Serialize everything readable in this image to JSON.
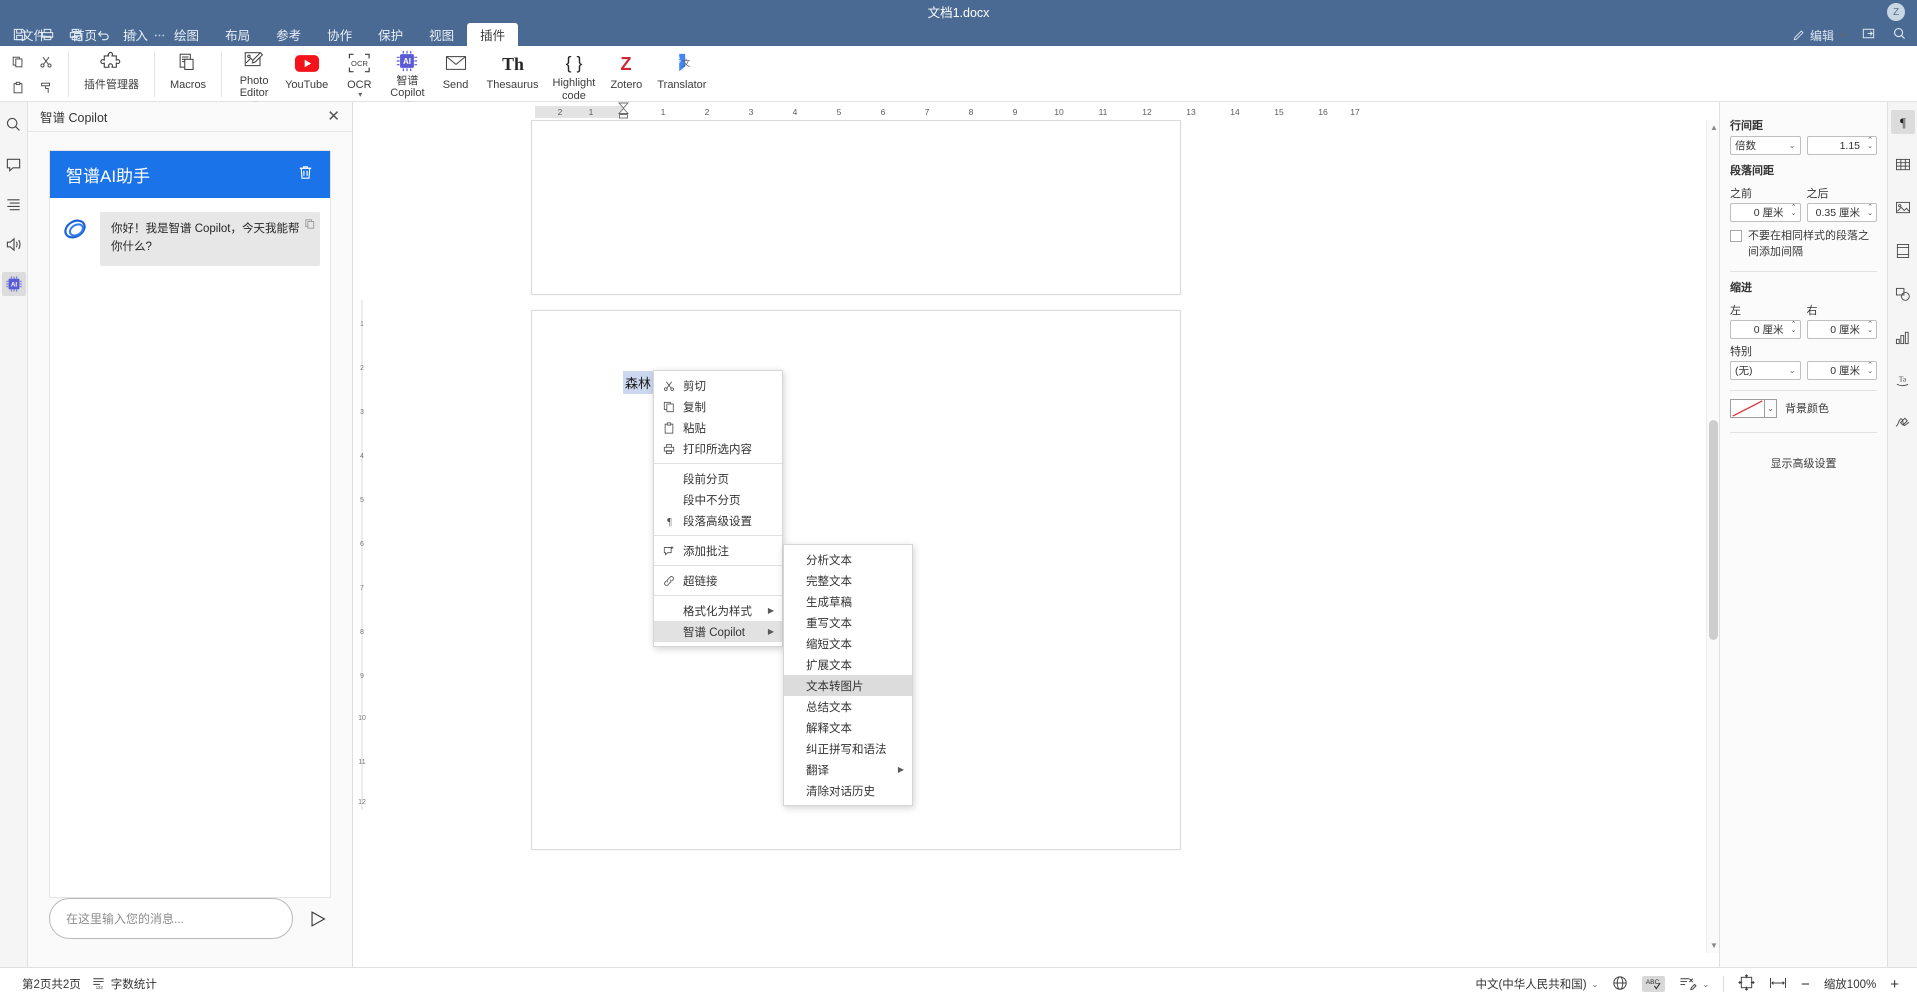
{
  "titlebar": {
    "doc_title": "文档1.docx",
    "avatar_initial": "Z",
    "quick_access": [
      "save-icon",
      "print-icon",
      "print-preview-icon",
      "undo-icon",
      "redo-icon",
      "more-icon"
    ],
    "edit_label": "编辑"
  },
  "tabs": [
    {
      "label": "文件",
      "active": false
    },
    {
      "label": "首页",
      "active": false
    },
    {
      "label": "插入",
      "active": false
    },
    {
      "label": "绘图",
      "active": false
    },
    {
      "label": "布局",
      "active": false
    },
    {
      "label": "参考",
      "active": false
    },
    {
      "label": "协作",
      "active": false
    },
    {
      "label": "保护",
      "active": false
    },
    {
      "label": "视图",
      "active": false
    },
    {
      "label": "插件",
      "active": true
    }
  ],
  "ribbon": {
    "clipboard": [
      "copy-icon",
      "cut-icon",
      "paste-icon",
      "format-painter-icon"
    ],
    "items": [
      {
        "label": "插件管理器",
        "icon": "puzzle-icon",
        "caret": false
      },
      {
        "label": "Macros",
        "icon": "macros-icon",
        "caret": false
      },
      {
        "label": "Photo\nEditor",
        "icon": "photo-editor-icon",
        "caret": true
      },
      {
        "label": "YouTube",
        "icon": "youtube-icon",
        "caret": false
      },
      {
        "label": "OCR",
        "icon": "ocr-icon",
        "caret": true
      },
      {
        "label": "智谱\nCopilot",
        "icon": "ai-chip-icon",
        "caret": true
      },
      {
        "label": "Send",
        "icon": "envelope-icon",
        "caret": false
      },
      {
        "label": "Thesaurus",
        "icon": "th-icon",
        "caret": false
      },
      {
        "label": "Highlight\ncode",
        "icon": "braces-icon",
        "caret": false
      },
      {
        "label": "Zotero",
        "icon": "zotero-z-icon",
        "caret": false
      },
      {
        "label": "Translator",
        "icon": "translator-icon",
        "caret": false
      }
    ]
  },
  "left_rail": [
    {
      "name": "search-icon",
      "active": false
    },
    {
      "name": "comment-icon",
      "active": false
    },
    {
      "name": "headings-icon",
      "active": false
    },
    {
      "name": "text-to-speech-icon",
      "active": false
    },
    {
      "name": "ai-plugin-icon",
      "active": true
    }
  ],
  "copilot": {
    "panel_title": "智谱 Copilot",
    "close_label": "✕",
    "banner_title": "智谱AI助手",
    "messages": [
      {
        "role": "assistant",
        "text": "你好！我是智谱 Copilot，今天我能帮你什么?"
      }
    ],
    "input_placeholder": "在这里输入您的消息...",
    "input_value": "",
    "send_icon": "send-icon",
    "delete_icon": "trash-icon",
    "copy_icon": "copy-icon",
    "banner_color": "#1a73e8"
  },
  "document": {
    "selected_text": "森林",
    "ruler_numbers_left": [
      "2",
      "1"
    ],
    "ruler_numbers_right": [
      "1",
      "2",
      "3",
      "4",
      "5",
      "6",
      "7",
      "8",
      "9",
      "10",
      "11",
      "12",
      "13",
      "14",
      "15",
      "16",
      "17"
    ]
  },
  "context_menu": {
    "groups": [
      [
        {
          "label": "剪切",
          "icon": "scissors-icon"
        },
        {
          "label": "复制",
          "icon": "copy-icon"
        },
        {
          "label": "粘贴",
          "icon": "paste-icon"
        },
        {
          "label": "打印所选内容",
          "icon": "printer-icon"
        }
      ],
      [
        {
          "label": "段前分页",
          "icon": ""
        },
        {
          "label": "段中不分页",
          "icon": ""
        },
        {
          "label": "段落高级设置",
          "icon": "pilcrow-icon"
        }
      ],
      [
        {
          "label": "添加批注",
          "icon": "add-comment-icon"
        }
      ],
      [
        {
          "label": "超链接",
          "icon": "link-icon"
        }
      ],
      [
        {
          "label": "格式化为样式",
          "icon": "",
          "arrow": true
        },
        {
          "label": "智谱 Copilot",
          "icon": "",
          "arrow": true,
          "highlighted": true
        }
      ]
    ]
  },
  "submenu": {
    "items": [
      {
        "label": "分析文本"
      },
      {
        "label": "完整文本"
      },
      {
        "label": "生成草稿"
      },
      {
        "label": "重写文本"
      },
      {
        "label": "缩短文本"
      },
      {
        "label": "扩展文本"
      },
      {
        "label": "文本转图片",
        "highlighted": true
      },
      {
        "label": "总结文本"
      },
      {
        "label": "解释文本"
      },
      {
        "label": "纠正拼写和语法"
      },
      {
        "label": "翻译",
        "arrow": true
      },
      {
        "label": "清除对话历史"
      }
    ]
  },
  "right_panel": {
    "line_spacing_label": "行间距",
    "line_spacing_mode": "倍数",
    "line_spacing_value": "1.15",
    "paragraph_spacing_label": "段落间距",
    "before_label": "之前",
    "after_label": "之后",
    "before_value": "0 厘米",
    "after_value": "0.35 厘米",
    "no_space_same_style": "不要在相同样式的段落之间添加间隔",
    "indent_label": "缩进",
    "left_label": "左",
    "right_label": "右",
    "indent_left_value": "0 厘米",
    "indent_right_value": "0 厘米",
    "special_label": "特别",
    "special_mode": "(无)",
    "special_value": "0 厘米",
    "background_color_label": "背景颜色",
    "advanced_settings_link": "显示高级设置"
  },
  "right_rail": [
    {
      "name": "paragraph-settings-icon",
      "active": true
    },
    {
      "name": "table-settings-icon",
      "active": false
    },
    {
      "name": "image-settings-icon",
      "active": false
    },
    {
      "name": "header-footer-settings-icon",
      "active": false
    },
    {
      "name": "shape-settings-icon",
      "active": false
    },
    {
      "name": "chart-settings-icon",
      "active": false
    },
    {
      "name": "text-art-settings-icon",
      "active": false
    },
    {
      "name": "signature-settings-icon",
      "active": false
    }
  ],
  "status_bar": {
    "page_info": "第2页共2页",
    "word_count": "字数统计",
    "language": "中文(中华人民共和国)",
    "spellcheck_icon": "abc-check-icon",
    "track_changes_icon": "track-changes-icon",
    "fit_page_icon": "fit-page-icon",
    "fit_width_icon": "fit-width-icon",
    "zoom_out": "−",
    "zoom_label": "缩放100%",
    "zoom_in": "+"
  }
}
